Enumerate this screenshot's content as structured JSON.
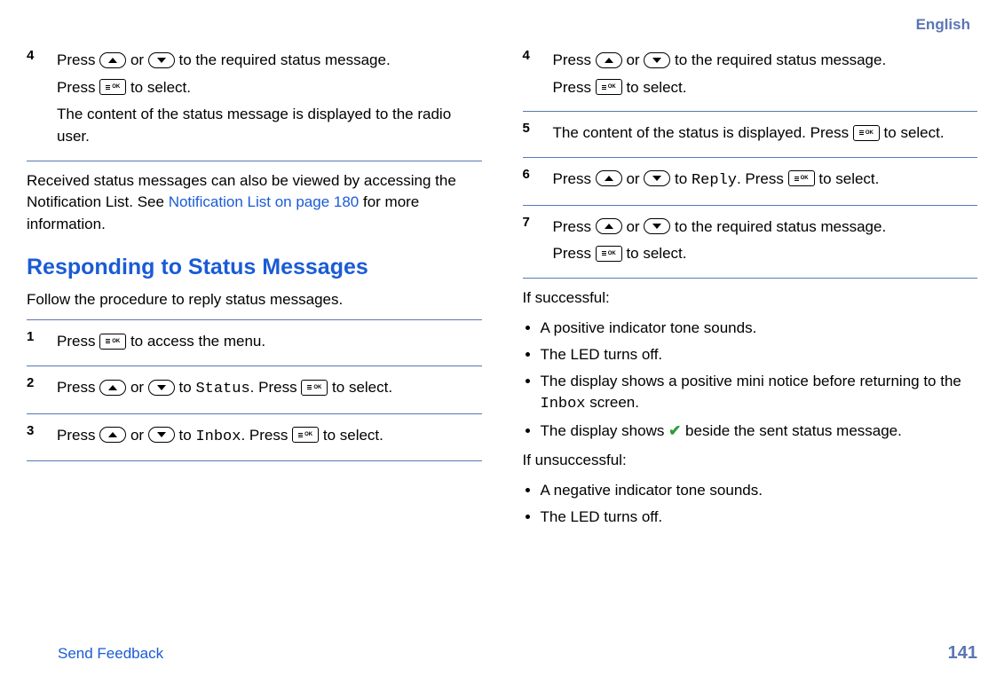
{
  "header": {
    "language": "English"
  },
  "footer": {
    "feedback": "Send Feedback",
    "page_number": "141"
  },
  "phrases": {
    "press": "Press",
    "or": "or",
    "to_required_status": "to the required status message.",
    "to_select": "to select.",
    "to": "to",
    "dot_press": ". Press",
    "to_access_menu": "to access the menu."
  },
  "mono": {
    "status": "Status",
    "inbox": "Inbox",
    "reply": "Reply"
  },
  "left": {
    "step4_line2": "The content of the status message is displayed to the radio user.",
    "received_para_a": "Received status messages can also be viewed by accessing the Notification List. See ",
    "received_link": "Notification List on page 180",
    "received_para_b": " for more information.",
    "section_title": "Responding to Status Messages",
    "section_intro": "Follow the procedure to reply status messages.",
    "steps": {
      "s1": "1",
      "s2": "2",
      "s3": "3",
      "s4": "4"
    }
  },
  "right": {
    "steps": {
      "s4": "4",
      "s5": "5",
      "s6": "6",
      "s7": "7"
    },
    "step5_text_a": "The content of the status is displayed. Press",
    "step5_text_b": "to select.",
    "if_successful": "If successful:",
    "if_unsuccessful": "If unsuccessful:",
    "success": {
      "b1": "A positive indicator tone sounds.",
      "b2": "The LED turns off.",
      "b3_a": "The display shows a positive mini notice before returning to the ",
      "b3_mono": "Inbox",
      "b3_b": " screen.",
      "b4_a": "The display shows ",
      "b4_b": " beside the sent status message."
    },
    "fail": {
      "b1": "A negative indicator tone sounds.",
      "b2": "The LED turns off."
    }
  }
}
